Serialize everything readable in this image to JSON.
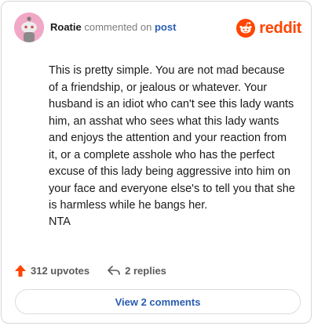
{
  "comment": {
    "username": "Roatie",
    "commented_on_text": "commented on",
    "post_link": "post",
    "body": "This is pretty simple. You are not mad because of a friendship, or jealous or whatever. Your husband is an idiot who can't see this lady wants him, an asshat who sees what this lady wants and enjoys the attention and your reaction from it, or a complete asshole who has the perfect excuse of this lady being aggressive into him on your face and everyone else's to tell you that she is harmless while he bangs her.",
    "verdict": "NTA"
  },
  "brand": {
    "name": "reddit",
    "color": "#ff4500"
  },
  "stats": {
    "upvotes": "312 upvotes",
    "replies": "2 replies"
  },
  "view_comments_label": "View 2 comments",
  "icons": {
    "upvote": "upvote-arrow-icon",
    "reply": "reply-arrow-icon",
    "logo": "reddit-alien-icon"
  }
}
